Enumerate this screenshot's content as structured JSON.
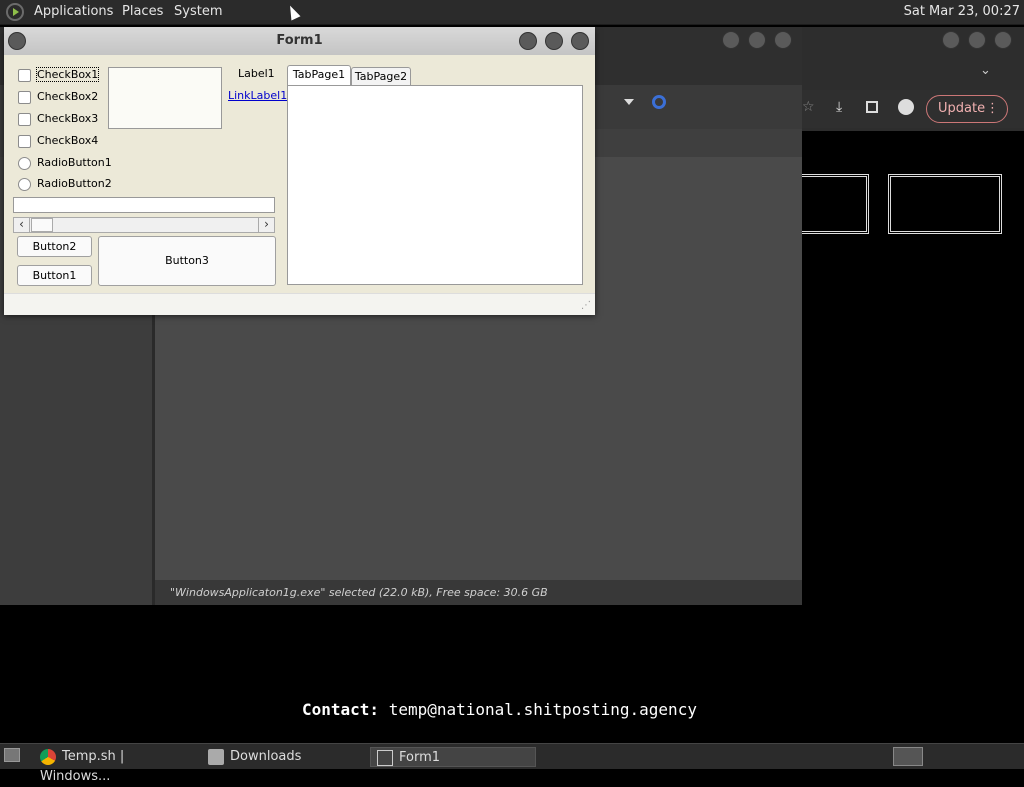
{
  "top_panel": {
    "menus": [
      "Applications",
      "Places",
      "System"
    ],
    "clock": "Sat Mar 23, 00:27"
  },
  "form1": {
    "title": "Form1",
    "checkboxes": [
      "CheckBox1",
      "CheckBox2",
      "CheckBox3",
      "CheckBox4"
    ],
    "radios": [
      "RadioButton1",
      "RadioButton2"
    ],
    "label1": "Label1",
    "linklabel1": "LinkLabel1",
    "buttons": {
      "button1": "Button1",
      "button2": "Button2",
      "button3": "Button3"
    },
    "tabs": [
      "TabPage1",
      "TabPage2"
    ]
  },
  "file_manager": {
    "status": "\"WindowsApplicaton1g.exe\" selected (22.0 kB), Free space: 30.6 GB"
  },
  "chrome": {
    "update_label": "Update"
  },
  "terminal": {
    "contact_label": "Contact:",
    "contact_value": "temp@national.shitposting.agency"
  },
  "taskbar": {
    "items": [
      "Temp.sh | Windows...",
      "Downloads",
      "Form1"
    ]
  },
  "colors": {
    "accent_link": "#0000cc",
    "update_border": "#cc7777"
  }
}
